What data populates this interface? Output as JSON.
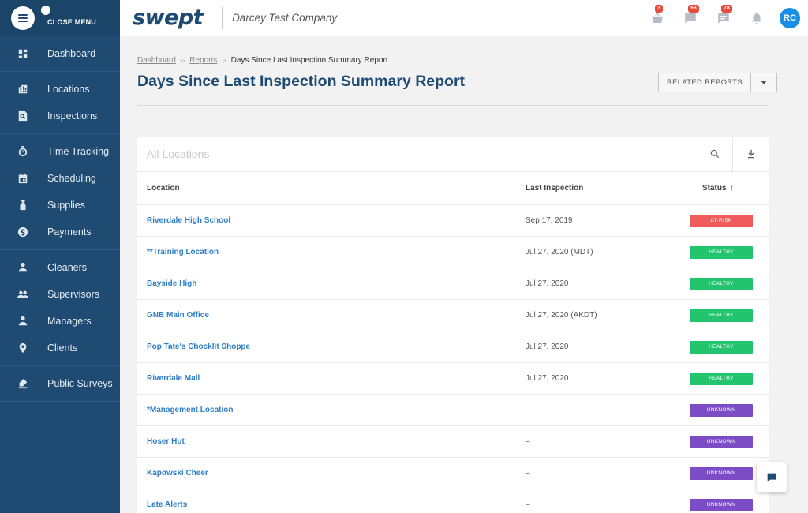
{
  "sidebar": {
    "close_label": "CLOSE MENU",
    "groups": [
      [
        {
          "label": "Dashboard",
          "icon": "dashboard-icon"
        }
      ],
      [
        {
          "label": "Locations",
          "icon": "building-icon"
        },
        {
          "label": "Inspections",
          "icon": "inspection-icon"
        }
      ],
      [
        {
          "label": "Time Tracking",
          "icon": "stopwatch-icon"
        },
        {
          "label": "Scheduling",
          "icon": "calendar-icon"
        },
        {
          "label": "Supplies",
          "icon": "spray-bottle-icon"
        },
        {
          "label": "Payments",
          "icon": "dollar-icon"
        }
      ],
      [
        {
          "label": "Cleaners",
          "icon": "person-icon"
        },
        {
          "label": "Supervisors",
          "icon": "people-icon"
        },
        {
          "label": "Managers",
          "icon": "person-icon"
        },
        {
          "label": "Clients",
          "icon": "pin-icon"
        }
      ],
      [
        {
          "label": "Public Surveys",
          "icon": "survey-icon"
        }
      ]
    ]
  },
  "topbar": {
    "logo": "swept",
    "company": "Darcey Test Company",
    "badges": {
      "cart": "3",
      "inbox": "53",
      "messages": "78"
    },
    "avatar": "RC"
  },
  "breadcrumb": {
    "home": "Dashboard",
    "reports": "Reports",
    "current": "Days Since Last Inspection Summary Report"
  },
  "page": {
    "title": "Days Since Last Inspection Summary Report",
    "related_label": "RELATED REPORTS"
  },
  "search": {
    "placeholder": "All Locations"
  },
  "table": {
    "headers": {
      "location": "Location",
      "last": "Last Inspection",
      "status": "Status"
    },
    "rows": [
      {
        "location": "Riverdale High School",
        "last": "Sep 17, 2019",
        "status": "AT-RISK",
        "kind": "risk"
      },
      {
        "location": "**Training Location",
        "last": "Jul 27, 2020 (MDT)",
        "status": "HEALTHY",
        "kind": "healthy"
      },
      {
        "location": "Bayside High",
        "last": "Jul 27, 2020",
        "status": "HEALTHY",
        "kind": "healthy"
      },
      {
        "location": "GNB Main Office",
        "last": "Jul 27, 2020 (AKDT)",
        "status": "HEALTHY",
        "kind": "healthy"
      },
      {
        "location": "Pop Tate's Chocklit Shoppe",
        "last": "Jul 27, 2020",
        "status": "HEALTHY",
        "kind": "healthy"
      },
      {
        "location": "Riverdale Mall",
        "last": "Jul 27, 2020",
        "status": "HEALTHY",
        "kind": "healthy"
      },
      {
        "location": "*Management Location",
        "last": "–",
        "status": "UNKNOWN",
        "kind": "unknown"
      },
      {
        "location": "Hoser Hut",
        "last": "–",
        "status": "UNKNOWN",
        "kind": "unknown"
      },
      {
        "location": "Kapowski Cheer",
        "last": "–",
        "status": "UNKNOWN",
        "kind": "unknown"
      },
      {
        "location": "Late Alerts",
        "last": "–",
        "status": "UNKNOWN",
        "kind": "unknown"
      }
    ]
  },
  "colors": {
    "sidebar": "#1f4b73",
    "link": "#2f7fc7",
    "risk": "#f05b5b",
    "healthy": "#22c46d",
    "unknown": "#7b4cc6"
  }
}
